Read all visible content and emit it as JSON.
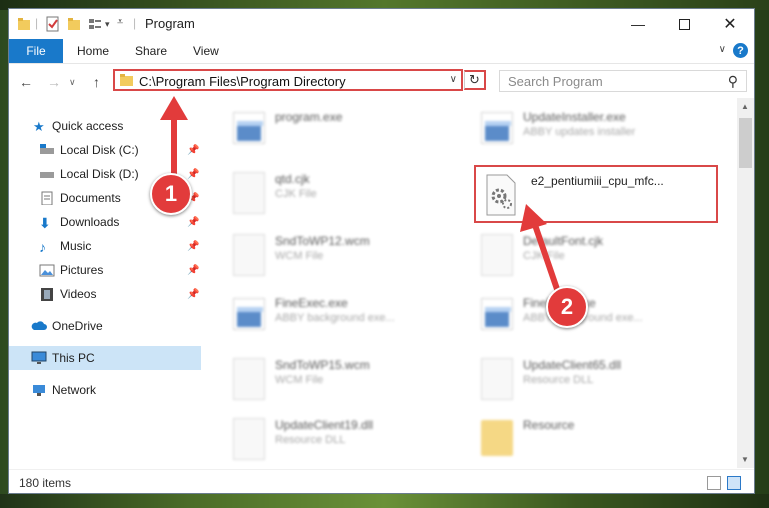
{
  "window": {
    "title": "Program"
  },
  "ribbon": {
    "file": "File",
    "tabs": [
      "Home",
      "Share",
      "View"
    ],
    "help": "?"
  },
  "address": {
    "path": "C:\\Program Files\\Program Directory",
    "search_placeholder": "Search Program"
  },
  "nav": {
    "items": [
      {
        "label": "Quick access",
        "icon": "star-icon"
      },
      {
        "label": "Local Disk (C:)",
        "icon": "drive-icon"
      },
      {
        "label": "Local Disk (D:)",
        "icon": "drive-icon"
      },
      {
        "label": "Documents",
        "icon": "documents-icon"
      },
      {
        "label": "Downloads",
        "icon": "downloads-icon"
      },
      {
        "label": "Music",
        "icon": "music-icon"
      },
      {
        "label": "Pictures",
        "icon": "pictures-icon"
      },
      {
        "label": "Videos",
        "icon": "videos-icon"
      },
      {
        "label": "OneDrive",
        "icon": "cloud-icon"
      },
      {
        "label": "This PC",
        "icon": "computer-icon"
      },
      {
        "label": "Network",
        "icon": "network-icon"
      }
    ]
  },
  "files": [
    {
      "name": "program.exe",
      "type": "",
      "icon": "exe-icon"
    },
    {
      "name": "UpdateInstaller.exe",
      "type": "ABBY updates installer",
      "icon": "exe-icon"
    },
    {
      "name": "qtd.cjk",
      "type": "CJK File",
      "icon": "document-icon"
    },
    {
      "name": "e2_pentiumiii_cpu_mfc...",
      "type": "",
      "icon": "gear-file-icon"
    },
    {
      "name": "SndToWP12.wcm",
      "type": "WCM File",
      "icon": "document-icon"
    },
    {
      "name": "DefaultFont.cjk",
      "type": "CJK File",
      "icon": "document-icon"
    },
    {
      "name": "FineExec.exe",
      "type": "ABBY background exe...",
      "icon": "exe-icon"
    },
    {
      "name": "FineExec.exe",
      "type": "ABBY background exe...",
      "icon": "exe-icon"
    },
    {
      "name": "SndToWP15.wcm",
      "type": "WCM File",
      "icon": "document-icon"
    },
    {
      "name": "UpdateClient65.dll",
      "type": "Resource DLL",
      "icon": "gear-file-icon"
    },
    {
      "name": "UpdateClient19.dll",
      "type": "Resource DLL",
      "icon": "gear-file-icon"
    },
    {
      "name": "Resource",
      "type": "",
      "icon": "folder-icon"
    }
  ],
  "status": {
    "count": "180 items"
  },
  "annotations": {
    "badge1": "1",
    "badge2": "2"
  },
  "colors": {
    "accent": "#1979ca",
    "annotation": "#e23b3b",
    "selection": "#cce4f7"
  }
}
